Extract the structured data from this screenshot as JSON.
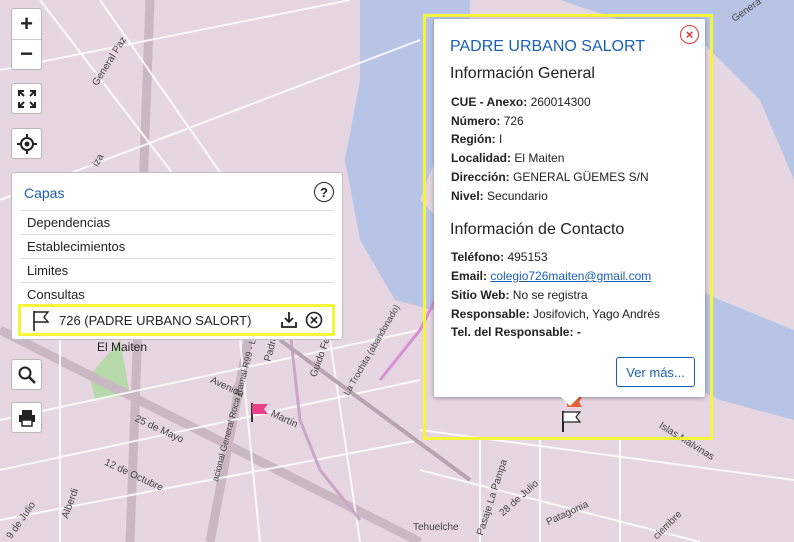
{
  "map": {
    "streets": [
      {
        "name": "General Paz",
        "label": "General Paz"
      },
      {
        "name": "iza",
        "label": "iza"
      },
      {
        "name": "el-maiten",
        "label": "El Maiten"
      },
      {
        "name": "padre",
        "label": "Padre"
      },
      {
        "name": "guido",
        "label": "Guido Fe"
      },
      {
        "name": "avenida",
        "label": "Avenida"
      },
      {
        "name": "martin",
        "label": "Martín"
      },
      {
        "name": "mayo",
        "label": "25 de Mayo"
      },
      {
        "name": "octubre",
        "label": "12 de Octubre"
      },
      {
        "name": "alberdi",
        "label": "Alberdi"
      },
      {
        "name": "julio9",
        "label": "9 de Julio"
      },
      {
        "name": "ruta",
        "label": "acional General Roca Ramal R99 - La Trochita"
      },
      {
        "name": "trochita",
        "label": "La Trochita (abandonado)"
      },
      {
        "name": "pampa",
        "label": "Pasaje La Pampa"
      },
      {
        "name": "julio28",
        "label": "28 de Julio"
      },
      {
        "name": "tehuelche",
        "label": "Tehuelche"
      },
      {
        "name": "patagonia",
        "label": "Patagonia"
      },
      {
        "name": "malvinas",
        "label": "Islas Malvinas"
      },
      {
        "name": "diciembre",
        "label": "ciembre"
      },
      {
        "name": "general",
        "label": "Genera"
      }
    ]
  },
  "controls": {
    "zoom_in": "+",
    "zoom_out": "−",
    "fullscreen_icon": "expand-icon",
    "locate_icon": "crosshair-icon",
    "search_icon": "search-icon",
    "print_icon": "printer-icon"
  },
  "layers_panel": {
    "title": "Capas",
    "help": "?",
    "items": [
      "Dependencias",
      "Establecimientos",
      "Limites",
      "Consultas"
    ],
    "selected": "726 (PADRE URBANO SALORT)"
  },
  "popup": {
    "title": "PADRE URBANO SALORT",
    "close": "×",
    "general_title": "Información General",
    "general": [
      {
        "label": "CUE - Anexo:",
        "value": "260014300"
      },
      {
        "label": "Número:",
        "value": "726"
      },
      {
        "label": "Región:",
        "value": "I"
      },
      {
        "label": "Localidad:",
        "value": "El Maiten"
      },
      {
        "label": "Dirección:",
        "value": "GENERAL GÜEMES S/N"
      },
      {
        "label": "Nivel:",
        "value": "Secundario"
      }
    ],
    "contact_title": "Información de Contacto",
    "contact": [
      {
        "label": "Teléfono:",
        "value": "495153"
      },
      {
        "label": "Email:",
        "value": "colegio726maiten@gmail.com"
      },
      {
        "label": "Sitio Web:",
        "value": "No se registra"
      },
      {
        "label": "Responsable:",
        "value": "Josifovich, Yago Andrés"
      },
      {
        "label": "Tel. del Responsable:",
        "value": "-"
      }
    ],
    "more": "Ver más..."
  },
  "colors": {
    "link": "#1a5fb4",
    "highlight": "#f5f53a",
    "map_bg": "#e6d6e2",
    "river": "#b8c4e6"
  }
}
